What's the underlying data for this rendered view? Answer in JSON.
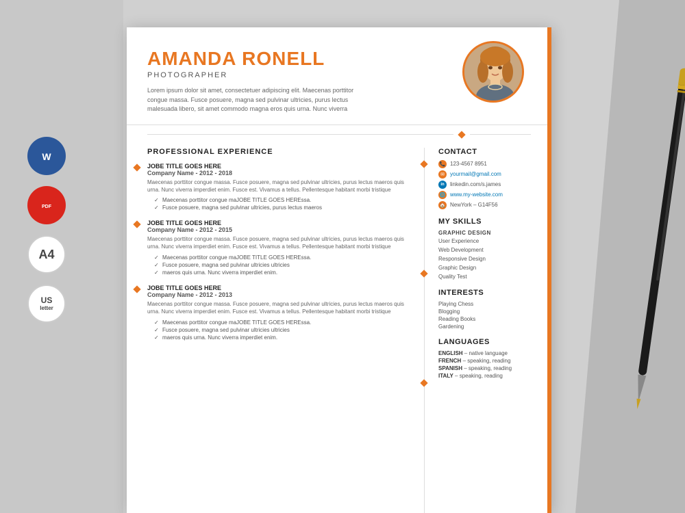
{
  "background": {
    "color": "#d0d0d0"
  },
  "side_icons": [
    {
      "id": "word",
      "label": "W",
      "type": "word"
    },
    {
      "id": "pdf",
      "label": "PDF",
      "type": "pdf"
    },
    {
      "id": "a4",
      "label": "A4",
      "type": "size"
    },
    {
      "id": "us",
      "label": "US\nletter",
      "type": "size"
    }
  ],
  "header": {
    "name": "AMANDA RONELL",
    "title": "PHOTOGRAPHER",
    "bio": "Lorem ipsum dolor sit amet, consectetuer adipiscing elit. Maecenas porttitor congue massa. Fusce posuere, magna sed pulvinar ultricies, purus lectus malesuada libero, sit amet commodo magna eros quis urna. Nunc viverra"
  },
  "experience": {
    "section_title": "PROFESSIONAL EXPERIENCE",
    "jobs": [
      {
        "title": "JOBE TITLE GOES HERE",
        "company": "Company Name  - 2012 - 2018",
        "desc": "Maecenas porttitor congue massa. Fusce posuere, magna sed pulvinar ultricies, purus lectus maeros quis urna. Nunc viverra imperdiet enim. Fusce est. Vivamus a tellus. Pellentesque habitant morbi tristique",
        "bullets": [
          "Maecenas porttitor congue maJOBE TITLE GOES HEREssa.",
          "Fusce posuere, magna sed pulvinar ultricies, purus lectus maeros"
        ]
      },
      {
        "title": "JOBE TITLE GOES HERE",
        "company": "Company Name  - 2012 - 2015",
        "desc": "Maecenas porttitor congue massa. Fusce posuere, magna sed pulvinar ultricies, purus lectus maeros quis urna. Nunc viverra imperdiet enim. Fusce est. Vivamus a tellus. Pellentesque habitant morbi tristique",
        "bullets": [
          "Maecenas porttitor congue maJOBE TITLE GOES HEREssa.",
          "Fusce posuere, magna sed pulvinar ultricies ultricies",
          "maeros quis urna. Nunc viverra imperdiet enim."
        ]
      },
      {
        "title": "JOBE TITLE GOES HERE",
        "company": "Company Name  - 2012 - 2013",
        "desc": "Maecenas porttitor congue massa. Fusce posuere, magna sed pulvinar ultricies, purus lectus maeros quis urna. Nunc viverra imperdiet enim. Fusce est. Vivamus a tellus. Pellentesque habitant morbi tristique",
        "bullets": [
          "Maecenas porttitor congue maJOBE TITLE GOES HEREssa.",
          "Fusce posuere, magna sed pulvinar ultricies ultricies",
          "maeros quis urna. Nunc viverra imperdiet enim."
        ]
      }
    ]
  },
  "contact": {
    "section_title": "CONTACT",
    "phone": "123-4567 8951",
    "email": "yourmail@gmail.com",
    "linkedin": "linkedin.com/s.james",
    "website": "www.my-website.com",
    "location": "NewYork – G14F56"
  },
  "skills": {
    "section_title": "MY SKILLS",
    "top_skill": "GRAPHIC DESIGN",
    "items": [
      "User Experience",
      "Web Development",
      "Responsive Design",
      "Graphic Design",
      "Quality Test"
    ]
  },
  "interests": {
    "section_title": "INTERESTS",
    "items": [
      "Playing Chess",
      "Blogging",
      "Reading Books",
      "Gardening"
    ]
  },
  "languages": {
    "section_title": "LANGUAGES",
    "items": [
      {
        "name": "ENGLISH",
        "level": "native language"
      },
      {
        "name": "FRENCH",
        "level": "speaking, reading"
      },
      {
        "name": "SPANISH",
        "level": "speaking, reading"
      },
      {
        "name": "ITALY",
        "level": "speaking, reading"
      }
    ]
  }
}
